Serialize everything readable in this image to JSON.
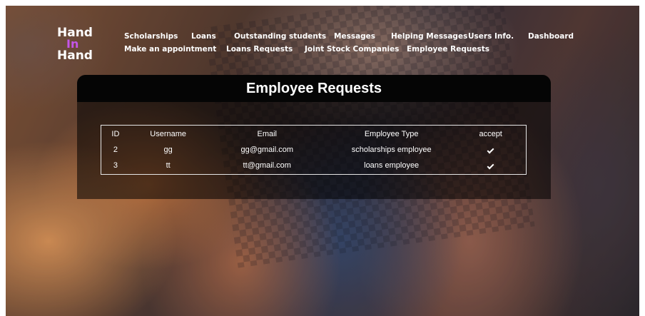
{
  "logo": {
    "line1": "Hand",
    "line2": "In",
    "line3": "Hand",
    "accent_color": "#c455e8"
  },
  "nav": {
    "row1": [
      "Scholarships",
      "Loans",
      "Outstanding students",
      "Messages",
      "Helping Messages",
      "Users Info.",
      "Dashboard"
    ],
    "row2": [
      "Make an appointment",
      "Loans Requests",
      "Joint Stock Companies",
      "Employee Requests"
    ]
  },
  "page": {
    "title": "Employee Requests"
  },
  "table": {
    "headers": [
      "ID",
      "Username",
      "Email",
      "Employee Type",
      "accept"
    ],
    "rows": [
      {
        "id": "2",
        "username": "gg",
        "email": "gg@gmail.com",
        "type": "scholarships employee",
        "accept_icon": "check-icon"
      },
      {
        "id": "3",
        "username": "tt",
        "email": "tt@gmail.com",
        "type": "loans employee",
        "accept_icon": "check-icon"
      }
    ]
  }
}
